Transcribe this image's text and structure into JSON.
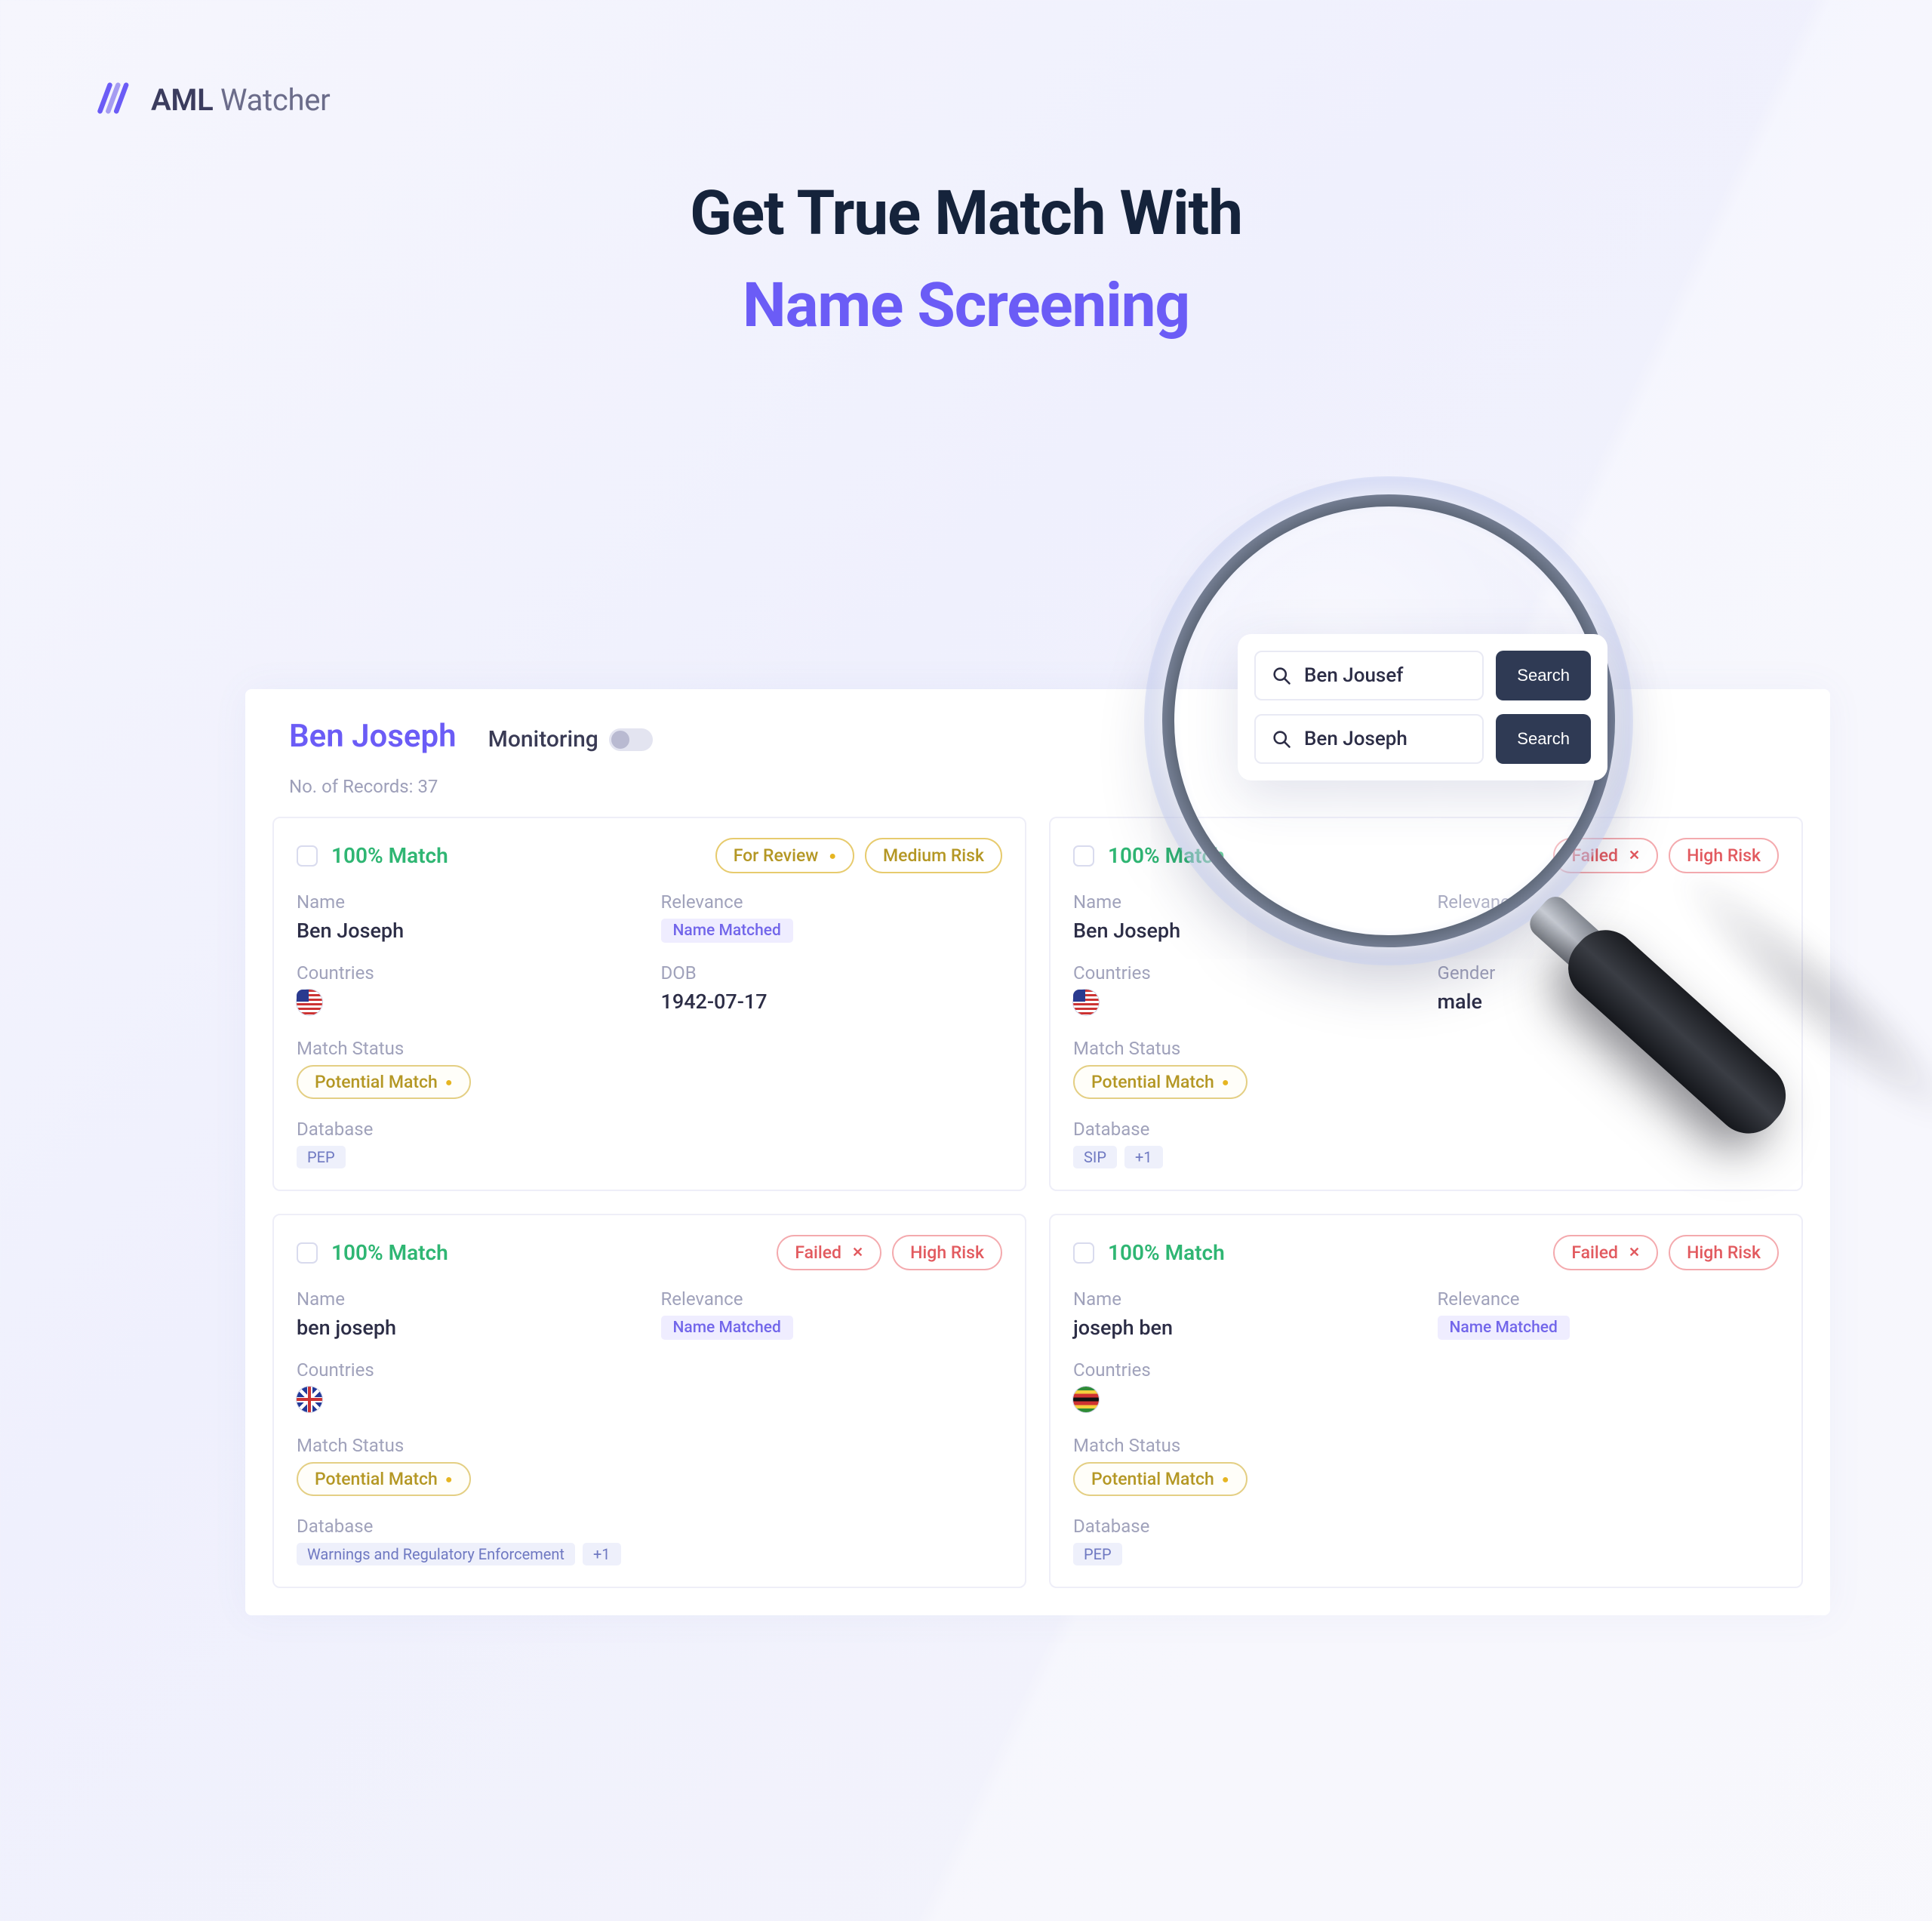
{
  "brand": {
    "bold": "AML",
    "light": "Watcher"
  },
  "hero": {
    "line1": "Get True Match With",
    "line2": "Name Screening"
  },
  "dash": {
    "name": "Ben Joseph",
    "monitoring": "Monitoring",
    "records": "No. of Records: 37"
  },
  "labels": {
    "Name": "Name",
    "Relevance": "Relevance",
    "Countries": "Countries",
    "DOB": "DOB",
    "Gender": "Gender",
    "MatchStatus": "Match Status",
    "Database": "Database"
  },
  "badges": {
    "forReview": "For Review",
    "mediumRisk": "Medium Risk",
    "highRisk": "High Risk",
    "failed": "Failed",
    "potentialMatch": "Potential Match",
    "nameMatched": "Name Matched",
    "plus1": "+1"
  },
  "cards": [
    {
      "match": "100% Match",
      "topBadges": [
        {
          "text": "forReview",
          "style": "yellow",
          "dot": true
        },
        {
          "text": "mediumRisk",
          "style": "yellow"
        }
      ],
      "name": "Ben Joseph",
      "relevance": "nameMatched",
      "countryFlag": "us",
      "extraLabel": "DOB",
      "extraValue": "1942-07-17",
      "db": [
        "PEP"
      ]
    },
    {
      "match": "100% Match",
      "topBadges": [
        {
          "text": "failed",
          "style": "red",
          "close": true
        },
        {
          "text": "highRisk",
          "style": "red"
        }
      ],
      "name": "Ben Joseph",
      "relevance": null,
      "countryFlag": "us",
      "extraLabel": "Gender",
      "extraValue": "male",
      "db": [
        "SIP",
        "+1"
      ]
    },
    {
      "match": "100% Match",
      "topBadges": [
        {
          "text": "failed",
          "style": "red",
          "close": true
        },
        {
          "text": "highRisk",
          "style": "red"
        }
      ],
      "name": "ben joseph",
      "relevance": "nameMatched",
      "countryFlag": "gb",
      "extraLabel": null,
      "extraValue": null,
      "db": [
        "Warnings and Regulatory Enforcement",
        "+1"
      ]
    },
    {
      "match": "100% Match",
      "topBadges": [
        {
          "text": "failed",
          "style": "red",
          "close": true
        },
        {
          "text": "highRisk",
          "style": "red"
        }
      ],
      "name": "joseph ben",
      "relevance": "nameMatched",
      "countryFlag": "zw",
      "extraLabel": null,
      "extraValue": null,
      "db": [
        "PEP"
      ]
    }
  ],
  "search": {
    "rows": [
      {
        "text": "Ben Jousef",
        "btn": "Search"
      },
      {
        "text": "Ben Joseph",
        "btn": "Search"
      }
    ]
  }
}
